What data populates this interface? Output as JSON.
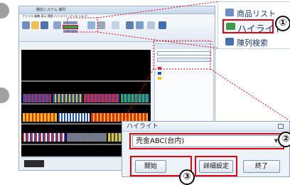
{
  "app": {
    "title": "棚割システム  陳列",
    "menu": "ファイル  編集  表示  棚割  ハイライト  ツール  ヘルプ"
  },
  "zoom1": {
    "item_product_list": "商品リスト",
    "item_highlight": "ハイライト",
    "item_display_search": "陳列検索",
    "marker": "①"
  },
  "dialog": {
    "title": "ハイライト",
    "selected_option": "売金ABC(台内)",
    "start_button": "開始",
    "detail_button": "詳細設定",
    "end_button": "終了",
    "marker_2": "②",
    "marker_3": "③"
  },
  "colors": {
    "accent_red": "#e60012",
    "dotted_guide": "#e60012",
    "product_palette": [
      "#e3262b",
      "#1e4fb5",
      "#f2c500",
      "#3aa84a",
      "#ffffff",
      "#9b59b6"
    ]
  }
}
